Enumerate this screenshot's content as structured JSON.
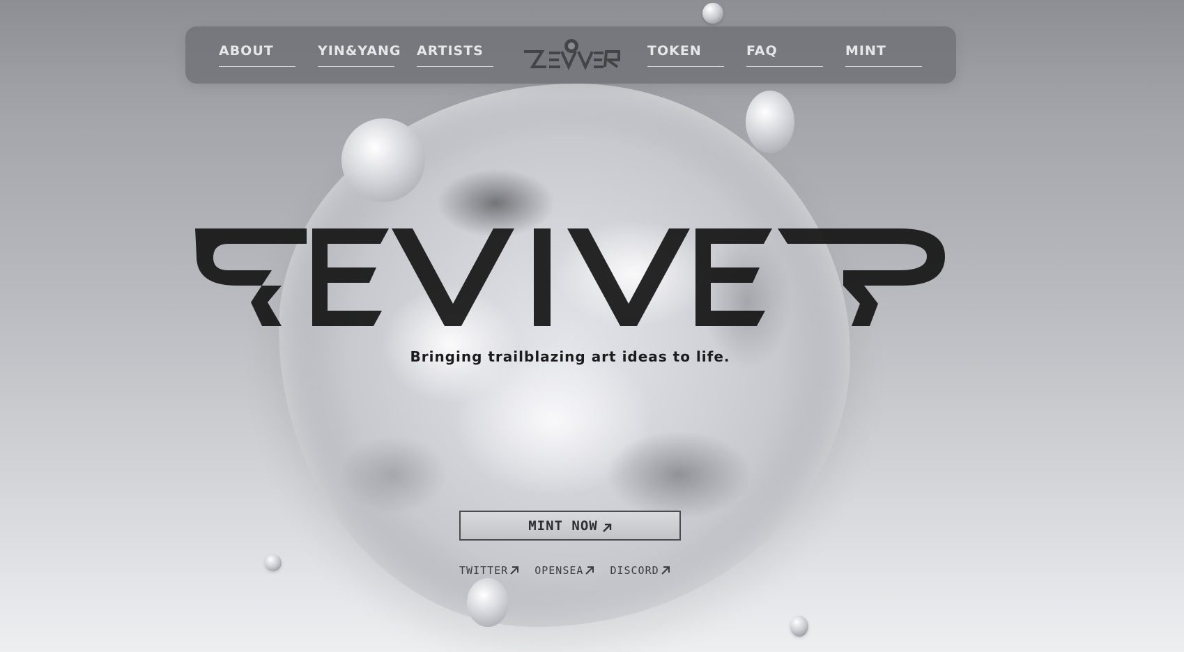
{
  "nav": {
    "items_left": [
      {
        "label": "ABOUT"
      },
      {
        "label": "YIN&YANG"
      },
      {
        "label": "ARTISTS"
      }
    ],
    "items_right": [
      {
        "label": "TOKEN"
      },
      {
        "label": "FAQ"
      },
      {
        "label": "MINT"
      }
    ],
    "logo_icon": "reviver-logo-icon"
  },
  "hero": {
    "wordmark_icon": "reviver-wordmark",
    "tagline": "Bringing trailblazing art ideas to life.",
    "cta_label": "MINT NOW",
    "cta_icon": "arrow-up-right-icon"
  },
  "socials": [
    {
      "label": "TWITTER",
      "icon": "arrow-up-right-icon"
    },
    {
      "label": "OPENSEA",
      "icon": "arrow-up-right-icon"
    },
    {
      "label": "DISCORD",
      "icon": "arrow-up-right-icon"
    }
  ],
  "colors": {
    "nav_bg": "#6e6f74",
    "text_dark": "#1c1c1e",
    "nav_text": "#e7e7ea"
  }
}
